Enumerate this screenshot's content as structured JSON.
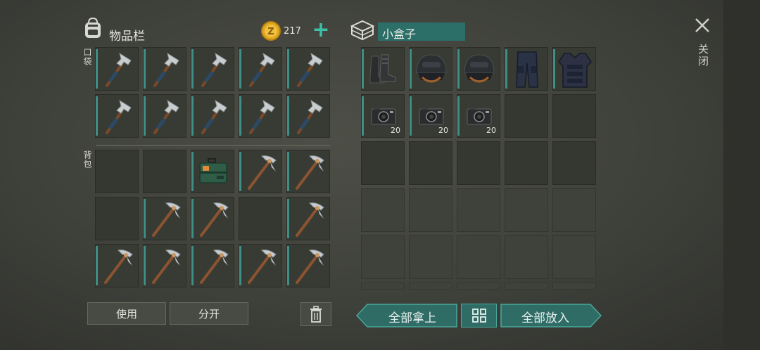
{
  "inventory": {
    "title": "物品栏",
    "coins": "217",
    "add_label": "+",
    "pocket_label": "口袋",
    "backpack_label": "背包",
    "pocket_slots": [
      "axe",
      "axe",
      "axe",
      "axe",
      "axe",
      "axe",
      "axe",
      "axe",
      "axe",
      "axe"
    ],
    "backpack_slots": [
      "",
      "",
      "toolbox",
      "pickaxe",
      "pickaxe",
      "",
      "pickaxe",
      "pickaxe",
      "",
      "pickaxe",
      "pickaxe",
      "pickaxe",
      "pickaxe",
      "pickaxe",
      "pickaxe"
    ],
    "use_button": "使用",
    "split_button": "分开",
    "trash_icon": "trash-icon"
  },
  "container": {
    "name": "小盒子",
    "items": [
      {
        "icon": "boots-icon",
        "qty": ""
      },
      {
        "icon": "helmet-icon",
        "qty": ""
      },
      {
        "icon": "helmet-icon",
        "qty": ""
      },
      {
        "icon": "pants-icon",
        "qty": ""
      },
      {
        "icon": "vest-icon",
        "qty": ""
      },
      {
        "icon": "camera-icon",
        "qty": "20"
      },
      {
        "icon": "camera-icon",
        "qty": "20"
      },
      {
        "icon": "camera-icon",
        "qty": "20"
      }
    ],
    "take_all_button": "全部拿上",
    "sort_icon": "grid-icon",
    "put_all_button": "全部放入"
  },
  "close": {
    "label": "关闭"
  },
  "colors": {
    "accent": "#3f8f86",
    "button_teal": "#2f6c66"
  }
}
